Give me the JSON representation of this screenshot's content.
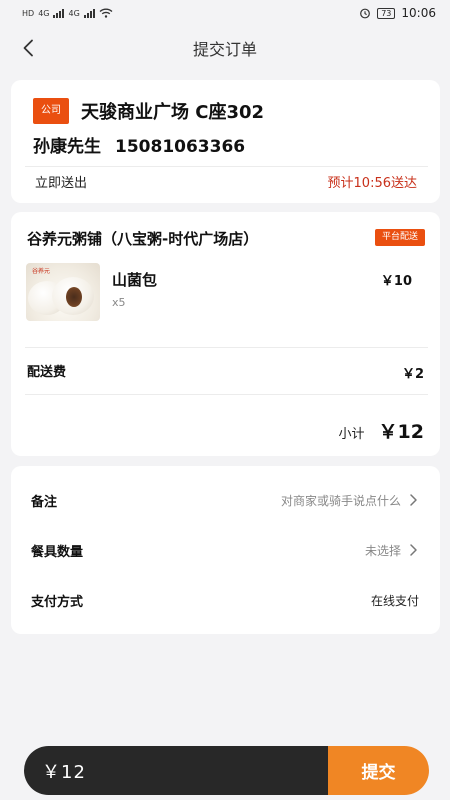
{
  "status": {
    "left_labels": [
      "HD",
      "4G",
      "4G"
    ],
    "battery": "73",
    "time": "10:06",
    "icons": [
      "signal-icon",
      "wifi-icon",
      "alarm-icon",
      "battery-icon"
    ]
  },
  "header": {
    "title": "提交订单",
    "back_icon": "chevron-left-icon"
  },
  "address": {
    "tag": "公司",
    "line": "天骏商业广场 C座302",
    "name": "孙康先生",
    "phone": "15081063366",
    "delivery_mode": "立即送出",
    "eta": "预计10:56送达"
  },
  "order": {
    "shop": "谷养元粥铺（八宝粥-时代广场店）",
    "badge": "平台配送",
    "item": {
      "brand": "谷养元",
      "name": "山菌包",
      "qty": "x5",
      "price": "￥10"
    },
    "fee_label": "配送费",
    "fee_value": "￥2",
    "subtotal_label": "小计",
    "subtotal_value": "￥12"
  },
  "extras": [
    {
      "label": "备注",
      "value": "对商家或骑手说点什么",
      "chevron": true
    },
    {
      "label": "餐具数量",
      "value": "未选择",
      "chevron": true
    },
    {
      "label": "支付方式",
      "value": "在线支付",
      "chevron": false
    }
  ],
  "footer": {
    "total": "￥12",
    "submit_label": "提交"
  },
  "colors": {
    "accent": "#ea4f10",
    "eta_red": "#c8301a",
    "submit_orange": "#f08624",
    "bar_dark": "#282828"
  }
}
